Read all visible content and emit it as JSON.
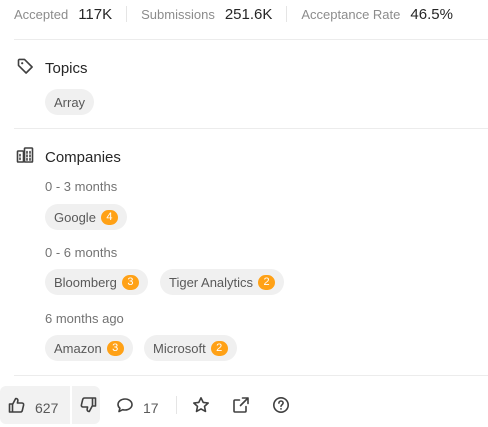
{
  "stats": {
    "accepted_label": "Accepted",
    "accepted_value": "117K",
    "submissions_label": "Submissions",
    "submissions_value": "251.6K",
    "acceptance_label": "Acceptance Rate",
    "acceptance_value": "46.5%"
  },
  "topics": {
    "title": "Topics",
    "icon": "tag-icon",
    "tags": [
      "Array"
    ]
  },
  "companies": {
    "title": "Companies",
    "icon": "building-icon",
    "groups": [
      {
        "range": "0 - 3 months",
        "items": [
          {
            "name": "Google",
            "count": "4"
          }
        ]
      },
      {
        "range": "0 - 6 months",
        "items": [
          {
            "name": "Bloomberg",
            "count": "3"
          },
          {
            "name": "Tiger Analytics",
            "count": "2"
          }
        ]
      },
      {
        "range": "6 months ago",
        "items": [
          {
            "name": "Amazon",
            "count": "3"
          },
          {
            "name": "Microsoft",
            "count": "2"
          }
        ]
      }
    ]
  },
  "footer": {
    "likes": "627",
    "comments": "17",
    "icons": [
      "thumbs-up-icon",
      "thumbs-down-icon",
      "comment-icon",
      "star-icon",
      "share-icon",
      "help-icon"
    ]
  },
  "colors": {
    "badge": "#ffa116",
    "tag_bg": "#f0f0f0",
    "divider": "#ececec"
  }
}
